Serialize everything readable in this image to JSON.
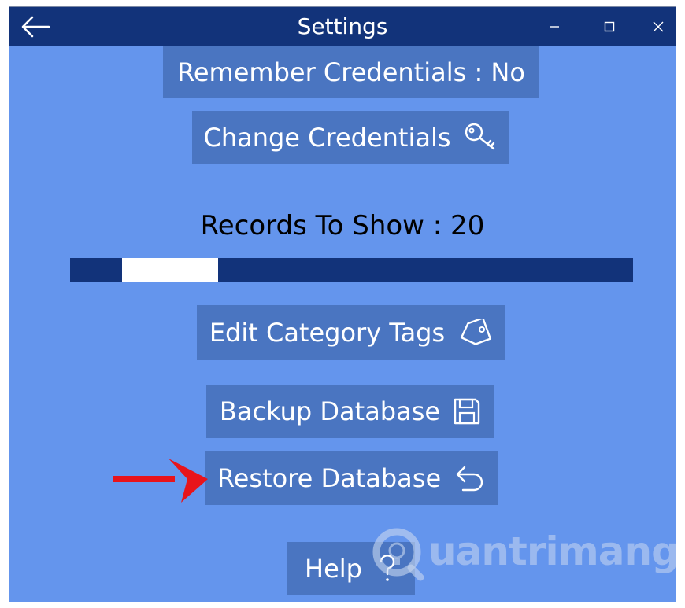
{
  "window": {
    "title": "Settings",
    "titlebar_color": "#12337a",
    "background_color": "#6495ed",
    "tile_color": "#4a75c1"
  },
  "titlebar": {
    "back_icon": "back-arrow-icon",
    "minimize_glyph": "–",
    "maximize_glyph": "☐",
    "close_glyph": "✕"
  },
  "settings": {
    "remember_credentials": "Remember Credentials : No",
    "change_credentials": "Change Credentials",
    "change_credentials_icon": "key-icon",
    "records_to_show": "Records To Show : 20",
    "records_value": 20,
    "edit_category_tags": "Edit Category Tags",
    "edit_category_tags_icon": "tag-icon",
    "backup_database": "Backup Database",
    "backup_database_icon": "save-icon",
    "restore_database": "Restore Database",
    "restore_database_icon": "undo-icon",
    "help": "Help",
    "help_icon": "question-icon"
  },
  "annotation": {
    "arrow_color": "#e8141b"
  },
  "watermark": {
    "text": "uantrimang"
  }
}
